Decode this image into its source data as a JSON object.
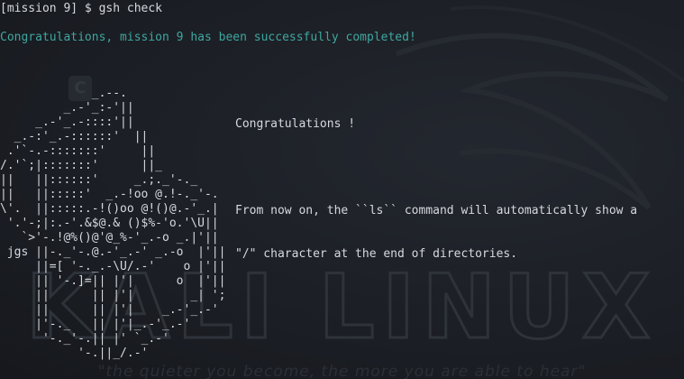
{
  "terminal": {
    "prompt": "[mission 9] $ gsh check",
    "success": "Congratulations, mission 9 has been successfully completed!",
    "ascii_art": [
      "             _.--.",
      "         _.-'_:-'||",
      "     _.-'_.-::::'||",
      "  _.-:'_.-::::::'  ||",
      " .'`-.-:::::::'     ||",
      "/.'`;|:::::::'      ||_",
      "||   ||::::::'     _.;._'-._",
      "||   ||:::::'  _.-!oo @.!-._'-.",
      "\\'.  ||:::::.-!()oo @!()@.-'_.|",
      " '.'-;|:.-'.&$@.& ()$%-'o.'\\U||",
      "   `>'-.!@%()@'@_%-'_.-o _.|'||",
      " jgs ||-._'-.@.-'_.-' _.-o  |'||",
      "     ||=[ '-._.-\\U/.-'    o |'||",
      "     || '-.]=|| |'|      o  |'||",
      "     ||      || |'|        _| ';",
      "     ||      || |'|    _.-'_.-'",
      "     |'-._   || |'|_.-'_.-'",
      "      '-._'-.|| |' `_.-'",
      "           '-.||_/.-'"
    ],
    "message": {
      "heading": "Congratulations !",
      "body_line1": "From now on, the ``ls`` command will automatically show a",
      "body_line2": "\"/\" character at the end of directories."
    }
  },
  "desktop_background": {
    "logo_text": "KALI LINUX",
    "tagline": "\"the quieter you become, the more you are able to hear\"",
    "icon_letter": "C"
  },
  "colors": {
    "background": "#1c1f25",
    "text": "#d6d9de",
    "success": "#3fa7a0",
    "watermark": "#2b2f36"
  }
}
